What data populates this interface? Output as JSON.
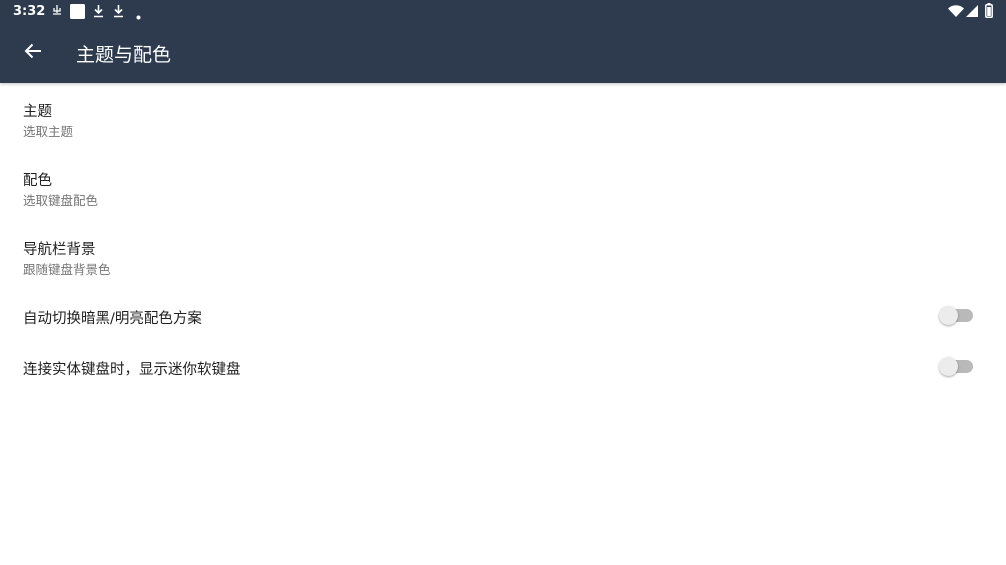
{
  "status_bar": {
    "time": "3:32",
    "left_icons": [
      "usb-debug-icon",
      "square-notification-icon",
      "download-icon",
      "download-icon",
      "dot-icon"
    ],
    "right_icons": [
      "wifi-icon",
      "cell-signal-icon",
      "battery-icon"
    ]
  },
  "toolbar": {
    "title": "主题与配色",
    "back_icon": "arrow-left-icon",
    "background": "#2e3b4e"
  },
  "preferences": [
    {
      "title": "主题",
      "summary": "选取主题"
    },
    {
      "title": "配色",
      "summary": "选取键盘配色"
    },
    {
      "title": "导航栏背景",
      "summary": "跟随键盘背景色"
    }
  ],
  "switches": [
    {
      "title": "自动切换暗黑/明亮配色方案",
      "checked": false
    },
    {
      "title": "连接实体键盘时，显示迷你软键盘",
      "checked": false
    }
  ]
}
